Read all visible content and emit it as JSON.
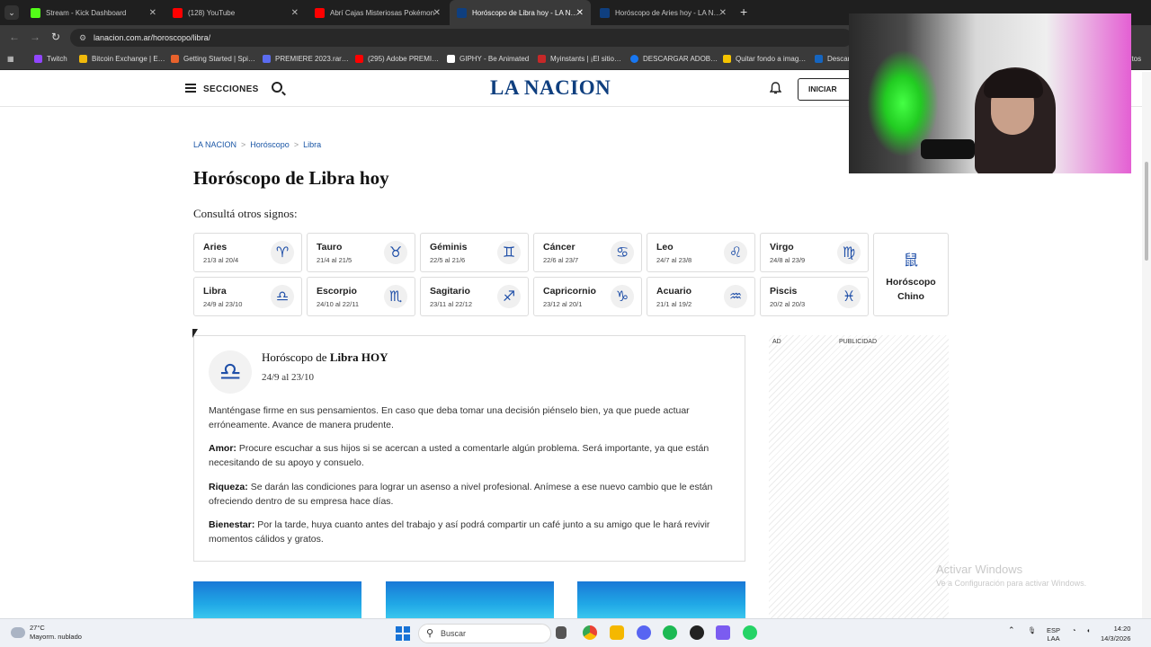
{
  "browser": {
    "tabs": [
      {
        "label": "Stream - Kick Dashboard",
        "color": "#53fc18"
      },
      {
        "label": "(128) YouTube",
        "color": "#ff0000"
      },
      {
        "label": "Abrí Cajas Misteriosas Pokémon",
        "color": "#ff0000"
      },
      {
        "label": "Horóscopo de Libra hoy - LA N…",
        "color": "#0f3f7f"
      },
      {
        "label": "Horóscopo de Aries hoy - LA N…",
        "color": "#0f3f7f"
      }
    ],
    "url": "lanacion.com.ar/horoscopo/libra/",
    "bookmarks": [
      {
        "label": "Twitch",
        "color": "#9146ff"
      },
      {
        "label": "Bitcoin Exchange | E…",
        "color": "#f0b90b"
      },
      {
        "label": "Getting Started | Spi…",
        "color": "#e8622c"
      },
      {
        "label": "PREMIERE 2023.rar…",
        "color": "#5b6cf0"
      },
      {
        "label": "(295) Adobe PREMI…",
        "color": "#ff0000"
      },
      {
        "label": "GIPHY - Be Animated",
        "color": "#ffffff"
      },
      {
        "label": "Myinstants | ¡El sitio…",
        "color": "#c62828"
      },
      {
        "label": "DESCARGAR ADOB…",
        "color": "#1877f2"
      },
      {
        "label": "Quitar fondo a imag…",
        "color": "#f5c400"
      },
      {
        "label": "Descar…",
        "color": "#1565c0"
      }
    ],
    "bookmarks_overflow": "…ritos"
  },
  "site": {
    "menu_label": "SECCIONES",
    "logo": "LA NACION",
    "login_label": "INICIAR SESIÓN"
  },
  "breadcrumb": [
    "LA NACION",
    "Horóscopo",
    "Libra"
  ],
  "page_title": "Horóscopo de Libra hoy",
  "consulta": "Consultá otros signos:",
  "signs": [
    {
      "name": "Aries",
      "dates": "21/3 al 20/4",
      "glyph": "♈"
    },
    {
      "name": "Tauro",
      "dates": "21/4 al 21/5",
      "glyph": "♉"
    },
    {
      "name": "Géminis",
      "dates": "22/5 al 21/6",
      "glyph": "♊"
    },
    {
      "name": "Cáncer",
      "dates": "22/6 al 23/7",
      "glyph": "♋"
    },
    {
      "name": "Leo",
      "dates": "24/7 al 23/8",
      "glyph": "♌"
    },
    {
      "name": "Virgo",
      "dates": "24/8 al 23/9",
      "glyph": "♍"
    },
    {
      "name": "Libra",
      "dates": "24/9 al 23/10",
      "glyph": "♎"
    },
    {
      "name": "Escorpio",
      "dates": "24/10 al 22/11",
      "glyph": "♏"
    },
    {
      "name": "Sagitario",
      "dates": "23/11 al 22/12",
      "glyph": "♐"
    },
    {
      "name": "Capricornio",
      "dates": "23/12 al 20/1",
      "glyph": "♑"
    },
    {
      "name": "Acuario",
      "dates": "21/1 al 19/2",
      "glyph": "♒"
    },
    {
      "name": "Piscis",
      "dates": "20/2 al 20/3",
      "glyph": "♓"
    }
  ],
  "chino": {
    "glyph": "鼠",
    "label": "Horóscopo Chino"
  },
  "card": {
    "glyph": "♎",
    "head_prefix": "Horóscopo de",
    "head_strong": "Libra HOY",
    "dates": "24/9 al 23/10",
    "intro": "Manténgase firme en sus pensamientos. En caso que deba tomar una decisión piénselo bien, ya que puede actuar erróneamente. Avance de manera prudente.",
    "amor_label": "Amor:",
    "amor": "Procure escuchar a sus hijos si se acercan a usted a comentarle algún problema. Será importante, ya que están necesitando de su apoyo y consuelo.",
    "riqueza_label": "Riqueza:",
    "riqueza": "Se darán las condiciones para lograr un asenso a nivel profesional. Anímese a ese nuevo cambio que le están ofreciendo dentro de su empresa hace días.",
    "bienestar_label": "Bienestar:",
    "bienestar": "Por la tarde, huya cuanto antes del trabajo y así podrá compartir un café junto a su amigo que le hará revivir momentos cálidos y gratos."
  },
  "ad": {
    "tag": "AD",
    "label": "PUBLICIDAD"
  },
  "watermark": {
    "line1": "Activar Windows",
    "line2": "Ve a Configuración para activar Windows."
  },
  "taskbar": {
    "temp": "27°C",
    "weather": "Mayorm. nublado",
    "search": "Buscar",
    "lang1": "ESP",
    "lang2": "LAA",
    "time": "14:20",
    "date": "14/3/2026"
  }
}
